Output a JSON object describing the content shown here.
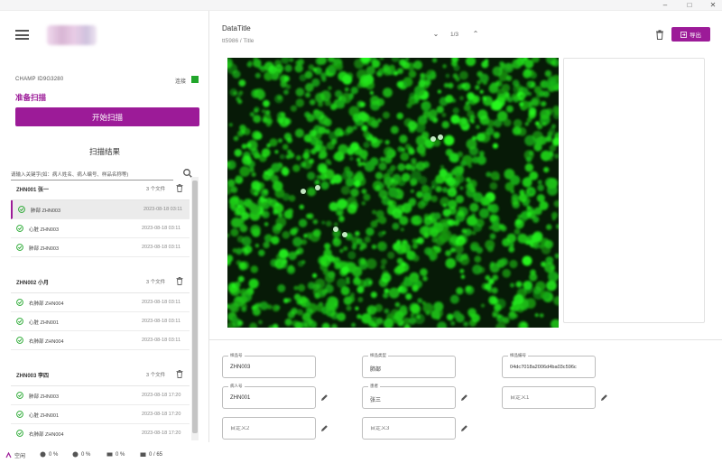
{
  "window": {
    "minimize": "–",
    "maximize": "□",
    "close": "✕"
  },
  "sidebar": {
    "device_id": "CHAMP ID9G3280",
    "connection_label": "连接",
    "status": "准备扫描",
    "start_button": "开始扫描",
    "results_title": "扫描结果",
    "search_placeholder": "请输入关键字(如：病人姓名、病人编号、样品名称等)",
    "groups": [
      {
        "name": "ZHN001 张一",
        "count": "3 个文件",
        "rows": [
          {
            "name": "肺部 ZHN003",
            "time": "2023-08-18 03:11",
            "selected": true
          },
          {
            "name": "心脏 ZHN003",
            "time": "2023-08-18 03:11",
            "selected": false
          },
          {
            "name": "肺部 ZHN003",
            "time": "2023-08-18 03:11",
            "selected": false
          }
        ]
      },
      {
        "name": "ZHN002 小月",
        "count": "3 个文件",
        "rows": [
          {
            "name": "右肺部 ZHN004",
            "time": "2023-08-18 03:11",
            "selected": false
          },
          {
            "name": "心脏 ZHN001",
            "time": "2023-08-18 03:11",
            "selected": false
          },
          {
            "name": "右肺部 ZHN004",
            "time": "2023-08-18 03:11",
            "selected": false
          }
        ]
      },
      {
        "name": "ZHN003 李四",
        "count": "3 个文件",
        "rows": [
          {
            "name": "肺部 ZHN003",
            "time": "2023-08-18 17:20",
            "selected": false
          },
          {
            "name": "心脏 ZHN001",
            "time": "2023-08-18 17:20",
            "selected": false
          },
          {
            "name": "右肺部 ZHN004",
            "time": "2023-08-18 17:20",
            "selected": false
          }
        ]
      }
    ]
  },
  "header": {
    "title": "DataTitle",
    "subtitle": "tt5986 / Title",
    "pager": "1/3",
    "export_label": "导出"
  },
  "fields": {
    "sample_no": {
      "label": "样品号",
      "value": "ZHN003"
    },
    "sample_type": {
      "label": "样品类型",
      "value": "肺部"
    },
    "sample_id": {
      "label": "样品编号",
      "value": "04dc7018a2006d4ba03c596c"
    },
    "patient_no": {
      "label": "病人号",
      "value": "ZHN001"
    },
    "patient_name": {
      "label": "患者",
      "value": "张三"
    },
    "custom1": {
      "label": "",
      "placeholder": "自定义1"
    },
    "custom2": {
      "label": "",
      "placeholder": "自定义2"
    },
    "custom3": {
      "label": "",
      "placeholder": "自定义3"
    }
  },
  "footer": {
    "status": "空闲",
    "cpu": "0 %",
    "memory": "0 %",
    "disk": "0 %",
    "files": "0 / 65"
  },
  "colors": {
    "accent": "#9c1b98",
    "connected": "#21a62b",
    "fluorescence": "#2fe02f"
  }
}
